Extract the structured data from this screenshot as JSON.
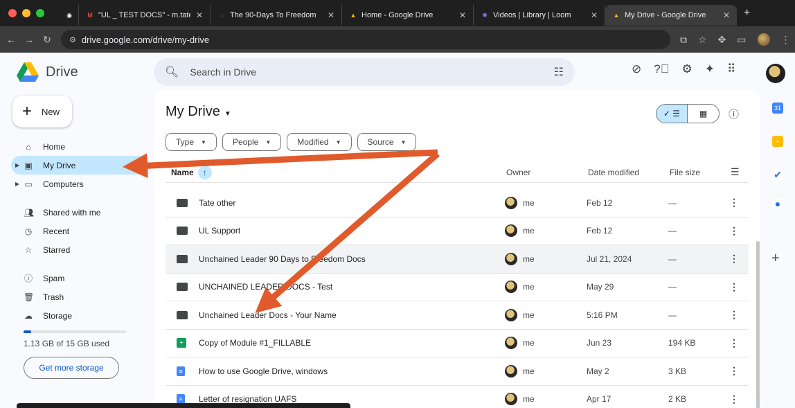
{
  "browser": {
    "tabs": [
      {
        "title": "",
        "icon": "record-icon"
      },
      {
        "title": "\"UL _ TEST DOCS\" - m.tate",
        "icon": "gmail-icon"
      },
      {
        "title": "The 90-Days To Freedom",
        "icon": "loading-icon"
      },
      {
        "title": "Home - Google Drive",
        "icon": "drive-icon"
      },
      {
        "title": "Videos | Library | Loom",
        "icon": "loom-icon"
      },
      {
        "title": "My Drive - Google Drive",
        "icon": "drive-icon",
        "active": true
      }
    ],
    "url": "drive.google.com/drive/my-drive"
  },
  "app": {
    "logo_text": "Drive",
    "search_placeholder": "Search in Drive",
    "new_button": "New",
    "nav": [
      {
        "label": "Home",
        "icon": "home-icon"
      },
      {
        "label": "My Drive",
        "icon": "my-drive-icon",
        "active": true
      },
      {
        "label": "Computers",
        "icon": "computer-icon"
      },
      {
        "label": "Shared with me",
        "icon": "people-icon"
      },
      {
        "label": "Recent",
        "icon": "clock-icon"
      },
      {
        "label": "Starred",
        "icon": "star-icon"
      },
      {
        "label": "Spam",
        "icon": "spam-icon"
      },
      {
        "label": "Trash",
        "icon": "trash-icon"
      },
      {
        "label": "Storage",
        "icon": "cloud-icon"
      }
    ],
    "storage_text": "1.13 GB of 15 GB used",
    "storage_fraction": 0.075,
    "get_storage": "Get more storage",
    "title": "My Drive",
    "chips": [
      "Type",
      "People",
      "Modified",
      "Source"
    ],
    "columns": {
      "name": "Name",
      "owner": "Owner",
      "date": "Date modified",
      "size": "File size"
    },
    "files": [
      {
        "name": "Tate other",
        "type": "folder",
        "owner": "me",
        "date": "Feb 12",
        "size": "—"
      },
      {
        "name": "UL Support",
        "type": "folder",
        "owner": "me",
        "date": "Feb 12",
        "size": "—"
      },
      {
        "name": "Unchained Leader 90 Days to Freedom Docs",
        "type": "folder",
        "owner": "me",
        "date": "Jul 21, 2024",
        "size": "—"
      },
      {
        "name": "UNCHAINED LEADER DOCS - Test",
        "type": "folder",
        "owner": "me",
        "date": "May 29",
        "size": "—"
      },
      {
        "name": "Unchained Leader Docs - Your Name",
        "type": "folder",
        "owner": "me",
        "date": "5:16 PM",
        "size": "—"
      },
      {
        "name": "Copy of Module #1_FILLABLE",
        "type": "sheet",
        "owner": "me",
        "date": "Jun 23",
        "size": "194 KB"
      },
      {
        "name": "How to use Google Drive, windows",
        "type": "doc",
        "owner": "me",
        "date": "May 2",
        "size": "3 KB"
      },
      {
        "name": "Letter of resignation UAFS",
        "type": "doc",
        "owner": "me",
        "date": "Apr 17",
        "size": "2 KB"
      }
    ]
  },
  "colors": {
    "accent": "#0b57d0",
    "active_nav": "#c2e7ff",
    "arrow": "#e05a2b"
  }
}
